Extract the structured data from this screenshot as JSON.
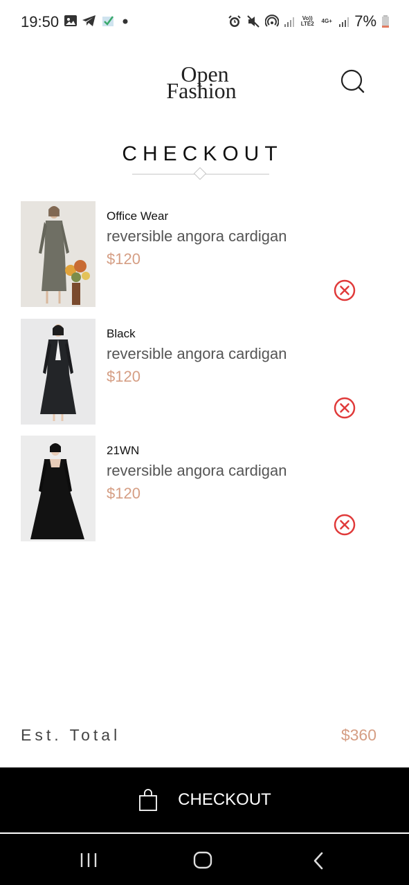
{
  "status_bar": {
    "time": "19:50",
    "battery": "7%",
    "net_label_1": "Vo)) LTE2",
    "net_label_2": "4G+"
  },
  "header": {
    "logo_line1": "Open",
    "logo_line2": "Fashion",
    "search_icon": "search-icon"
  },
  "page": {
    "title": "CHECKOUT"
  },
  "cart": {
    "items": [
      {
        "brand": "Office Wear",
        "name": "reversible angora cardigan",
        "price": "$120",
        "image": "grey-dress-photo"
      },
      {
        "brand": "Black",
        "name": "reversible angora cardigan",
        "price": "$120",
        "image": "black-coat-dress-photo"
      },
      {
        "brand": "21WN",
        "name": "reversible angora cardigan",
        "price": "$120",
        "image": "black-a-line-dress-photo"
      }
    ]
  },
  "summary": {
    "total_label": "Est. Total",
    "total_value": "$360"
  },
  "checkout_button": {
    "label": "CHECKOUT",
    "icon": "shopping-bag-icon"
  },
  "colors": {
    "accent_price": "#d59e84",
    "remove_red": "#e03a3a",
    "checkout_bg": "#000000"
  }
}
